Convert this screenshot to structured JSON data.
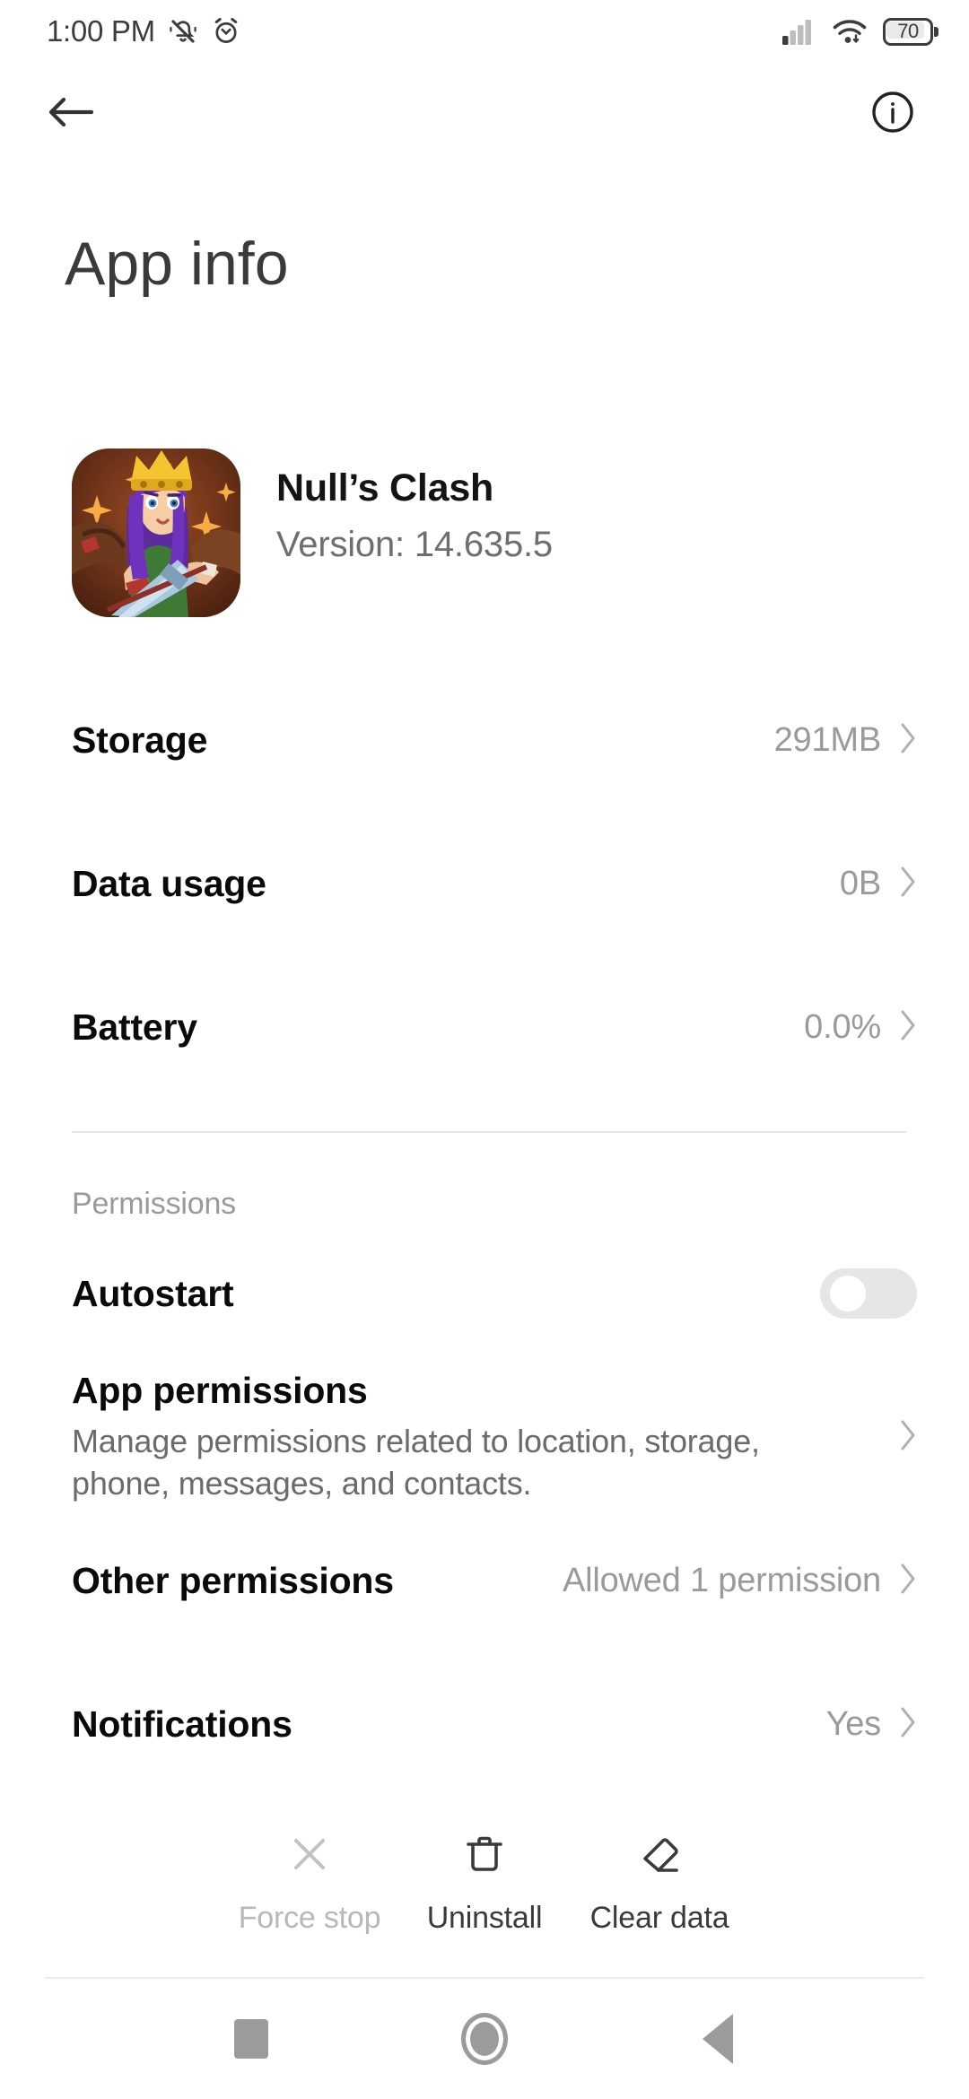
{
  "statusbar": {
    "time": "1:00 PM",
    "silent_icon": "bell-slash-icon",
    "alarm_icon": "alarm-clock-icon",
    "signal_icon": "cellular-signal-icon",
    "wifi_icon": "wifi-icon",
    "battery_level": "70"
  },
  "topbar": {
    "back_icon": "back-arrow-icon",
    "info_icon": "info-circle-icon"
  },
  "page": {
    "title": "App info"
  },
  "app": {
    "name": "Null’s Clash",
    "version": "Version: 14.635.5",
    "icon_name": "nulls-clash-app-icon"
  },
  "rows": [
    {
      "title": "Storage",
      "value": "291MB",
      "type": "chevron"
    },
    {
      "title": "Data usage",
      "value": "0B",
      "type": "chevron"
    },
    {
      "title": "Battery",
      "value": "0.0%",
      "type": "chevron"
    }
  ],
  "permissions": {
    "section_label": "Permissions",
    "autostart": {
      "title": "Autostart",
      "toggle_state": "off"
    },
    "app_permissions": {
      "title": "App permissions",
      "subtitle": "Manage permissions related to location, storage, phone, messages, and contacts."
    },
    "other_permissions": {
      "title": "Other permissions",
      "value": "Allowed 1 permission"
    },
    "notifications": {
      "title": "Notifications",
      "value": "Yes"
    }
  },
  "actions": [
    {
      "label": "Force stop",
      "icon": "close-x-icon",
      "state": "disabled"
    },
    {
      "label": "Uninstall",
      "icon": "trash-icon",
      "state": "enabled"
    },
    {
      "label": "Clear data",
      "icon": "eraser-icon",
      "state": "enabled"
    }
  ],
  "navbar": {
    "recents_icon": "square-recents-icon",
    "home_icon": "circle-home-icon",
    "back_icon": "triangle-back-icon"
  },
  "colors": {
    "background": "#ffffff",
    "primary_text": "#0a0a0a",
    "secondary_text": "#9a9a9a",
    "divider": "#e6e6e6",
    "toggle_off_track": "#e6e6e6",
    "nav_icon": "#9b9b9b"
  }
}
